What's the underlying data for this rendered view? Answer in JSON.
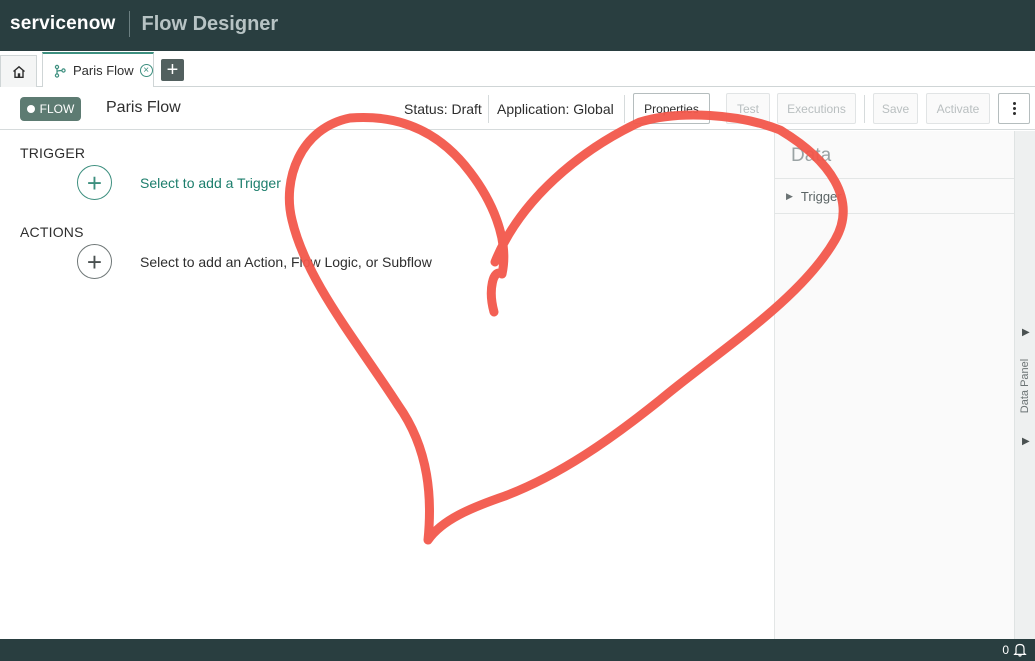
{
  "header": {
    "logo": "servicenow",
    "app_title": "Flow Designer"
  },
  "tabs": {
    "flow_tab_label": "Paris Flow",
    "add_tab_label": "+"
  },
  "flowbar": {
    "badge": "FLOW",
    "flow_name": "Paris Flow",
    "status": "Status: Draft",
    "application": "Application: Global",
    "buttons": {
      "properties": "Properties",
      "test": "Test",
      "executions": "Executions",
      "save": "Save",
      "activate": "Activate"
    }
  },
  "trigger": {
    "title": "TRIGGER",
    "add_label": "Select to add a Trigger"
  },
  "actions": {
    "title": "ACTIONS",
    "add_label": "Select to add an Action, Flow Logic, or Subflow"
  },
  "data_panel": {
    "title": "Data",
    "rows": [
      "Trigger"
    ],
    "rail_label": "Data Panel"
  },
  "footer": {
    "notification_count": "0"
  },
  "annotation": {
    "color": "#f2574b",
    "shape": "heart"
  },
  "colors": {
    "header_bg": "#293e40",
    "accent_green": "#3d8f7f",
    "flow_badge": "#5d7b72"
  }
}
